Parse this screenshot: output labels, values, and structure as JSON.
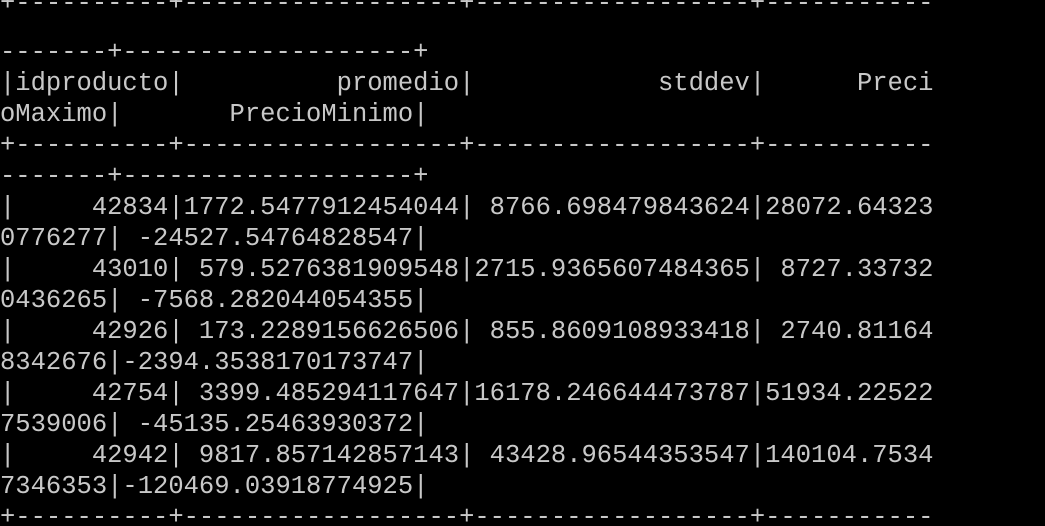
{
  "terminal": {
    "lines": [
      "+----------+------------------+------------------+-----------",
      "-------+-------------------+",
      "|idproducto|          promedio|            stddev|      Preci",
      "oMaximo|       PrecioMinimo|",
      "+----------+------------------+------------------+-----------",
      "-------+-------------------+",
      "|     42834|1772.5477912454044| 8766.698479843624|28072.64323",
      "0776277| -24527.54764828547|",
      "|     43010| 579.5276381909548|2715.9365607484365| 8727.33732",
      "0436265| -7568.282044054355|",
      "|     42926| 173.2289156626506| 855.8609108933418| 2740.81164",
      "8342676|-2394.3538170173747|",
      "|     42754| 3399.485294117647|16178.246644473787|51934.22522",
      "7539006| -45135.25463930372|",
      "|     42942| 9817.857142857143| 43428.96544353547|140104.7534",
      "7346353|-120469.03918774925|",
      "+----------+------------------+------------------+-----------"
    ],
    "colors": {
      "background": "#000000",
      "text": "#c8c8c8"
    }
  }
}
